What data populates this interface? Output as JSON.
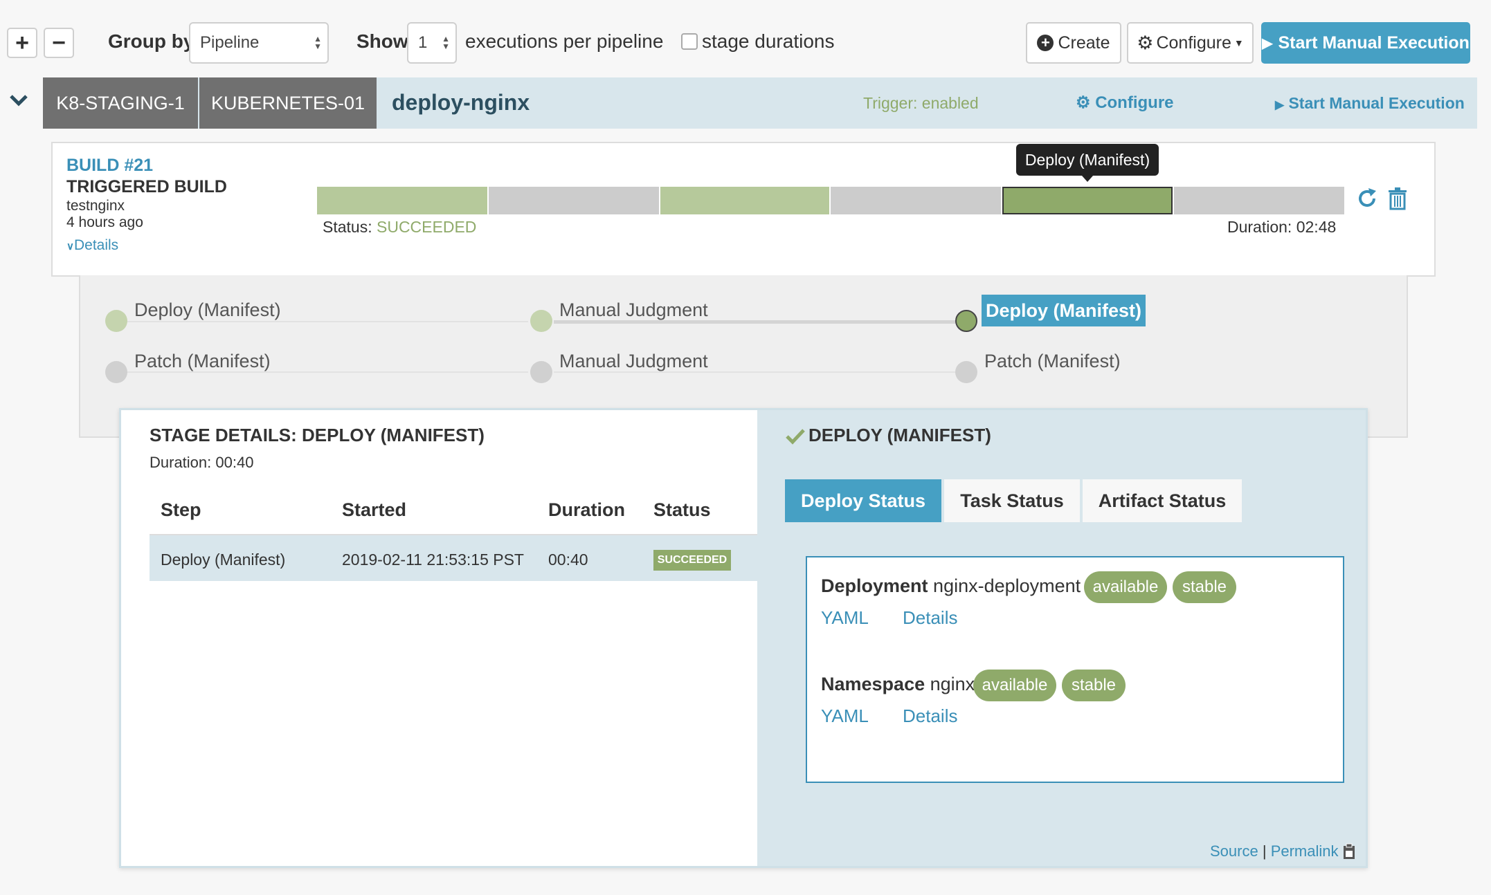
{
  "toolbar": {
    "expand_all": "+",
    "collapse_all": "−",
    "group_by_label": "Group by",
    "group_by_value": "Pipeline",
    "show_label": "Show",
    "show_value": "1",
    "executions_label": "executions per pipeline",
    "stage_durations_label": "stage durations",
    "create_label": "Create",
    "configure_label": "Configure",
    "start_manual_label": "Start Manual Execution"
  },
  "pipeline": {
    "accounts": [
      "K8-STAGING-1",
      "KUBERNETES-01"
    ],
    "name": "deploy-nginx",
    "trigger_status": "Trigger: enabled",
    "configure_label": "Configure",
    "start_manual_label": "Start Manual Execution"
  },
  "execution": {
    "build": "BUILD #21",
    "trigger_type": "TRIGGERED BUILD",
    "trigger_name": "testnginx",
    "time_ago": "4 hours ago",
    "details_label": "Details",
    "status_label": "Status:",
    "status_value": "SUCCEEDED",
    "duration_label": "Duration: 02:48",
    "tooltip": "Deploy (Manifest)"
  },
  "graph": {
    "row1": [
      "Deploy (Manifest)",
      "Manual Judgment",
      "Deploy (Manifest)"
    ],
    "row2": [
      "Patch (Manifest)",
      "Manual Judgment",
      "Patch (Manifest)"
    ]
  },
  "stage_details": {
    "title": "STAGE DETAILS: DEPLOY (MANIFEST)",
    "duration": "Duration: 00:40",
    "columns": [
      "Step",
      "Started",
      "Duration",
      "Status"
    ],
    "rows": [
      {
        "step": "Deploy (Manifest)",
        "started": "2019-02-11 21:53:15 PST",
        "duration": "00:40",
        "status": "SUCCEEDED"
      }
    ]
  },
  "deploy_panel": {
    "title": "DEPLOY (MANIFEST)",
    "tabs": [
      "Deploy Status",
      "Task Status",
      "Artifact Status"
    ],
    "resources": [
      {
        "kind": "Deployment",
        "name": "nginx-deployment",
        "badges": [
          "available",
          "stable"
        ],
        "links": [
          "YAML",
          "Details"
        ]
      },
      {
        "kind": "Namespace",
        "name": "nginx",
        "badges": [
          "available",
          "stable"
        ],
        "links": [
          "YAML",
          "Details"
        ]
      }
    ],
    "footer_source": "Source",
    "footer_separator": "|",
    "footer_permalink": "Permalink"
  },
  "colors": {
    "accent": "#46a0c4",
    "success": "#8faa6a",
    "success_light": "#b6c99b",
    "header_bg": "#d8e6ec"
  }
}
